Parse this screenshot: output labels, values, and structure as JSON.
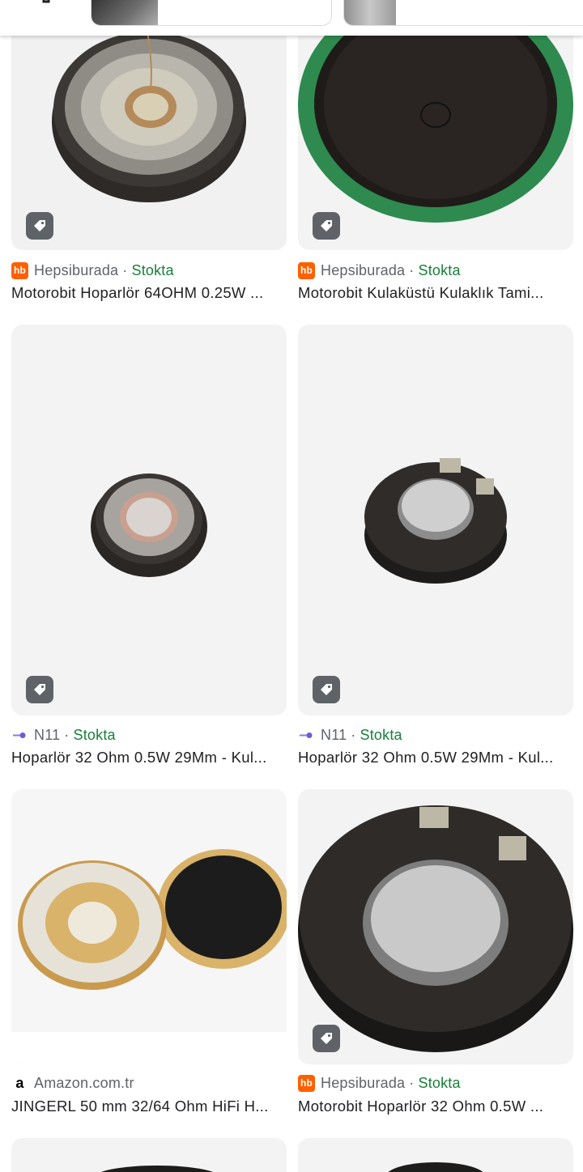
{
  "colors": {
    "stock": "#188038",
    "tag_bg": "#5f6368",
    "hb_brand": "#ff6000"
  },
  "cards": [
    {
      "source": "Hepsiburada",
      "stock": "Stokta",
      "title": "Motorobit Hoparlör 64OHM 0.25W ...",
      "favicon": "hepsiburada-icon",
      "fav_text": "hb"
    },
    {
      "source": "Hepsiburada",
      "stock": "Stokta",
      "title": "Motorobit Kulaküstü Kulaklık Tami...",
      "favicon": "hepsiburada-icon",
      "fav_text": "hb"
    },
    {
      "source": "N11",
      "stock": "Stokta",
      "title": "Hoparlör 32 Ohm 0.5W 29Mm - Kul...",
      "favicon": "n11-icon"
    },
    {
      "source": "N11",
      "stock": "Stokta",
      "title": "Hoparlör 32 Ohm 0.5W 29Mm - Kul...",
      "favicon": "n11-icon"
    },
    {
      "source": "Amazon.com.tr",
      "stock": "",
      "title": "JINGERL 50 mm 32/64 Ohm HiFi H...",
      "favicon": "amazon-icon",
      "fav_text": "a"
    },
    {
      "source": "Hepsiburada",
      "stock": "Stokta",
      "title": "Motorobit Hoparlör 32 Ohm 0.5W ...",
      "favicon": "hepsiburada-icon",
      "fav_text": "hb"
    }
  ],
  "separator": "·"
}
